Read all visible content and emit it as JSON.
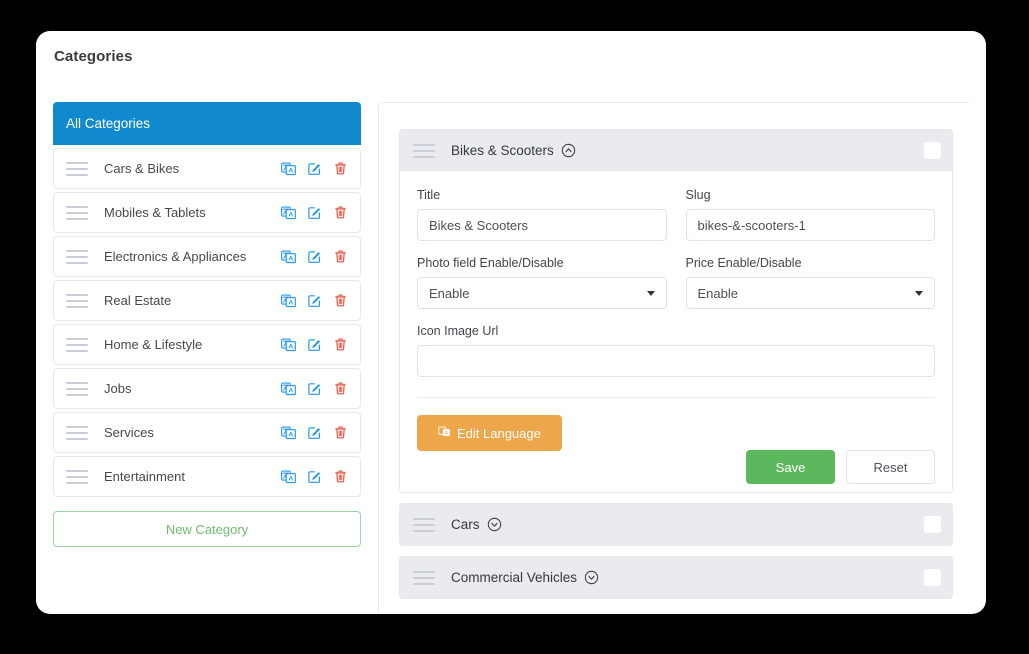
{
  "page": {
    "title": "Categories"
  },
  "sidebar": {
    "header_label": "All Categories",
    "new_category_label": "New Category",
    "row_icons": {
      "drag": "drag-handle-icon",
      "translate": "translate-icon",
      "edit": "edit-pencil-icon",
      "delete": "trash-icon"
    },
    "items": [
      {
        "label": "Cars & Bikes"
      },
      {
        "label": "Mobiles & Tablets"
      },
      {
        "label": "Electronics & Appliances"
      },
      {
        "label": "Real Estate"
      },
      {
        "label": "Home & Lifestyle"
      },
      {
        "label": "Jobs"
      },
      {
        "label": "Services"
      },
      {
        "label": "Entertainment"
      }
    ]
  },
  "main": {
    "panels": [
      {
        "title": "Bikes & Scooters",
        "expanded": true,
        "caret_icon": "chevron-up-circle-icon",
        "checked": false
      },
      {
        "title": "Cars",
        "expanded": false,
        "caret_icon": "chevron-down-circle-icon",
        "checked": false
      },
      {
        "title": "Commercial Vehicles",
        "expanded": false,
        "caret_icon": "chevron-down-circle-icon",
        "checked": false
      }
    ],
    "form": {
      "title_label": "Title",
      "title_value": "Bikes & Scooters",
      "title_placeholder": "Title",
      "slug_label": "Slug",
      "slug_value": "bikes-&-scooters-1",
      "slug_placeholder": "Slug",
      "photo_label": "Photo field Enable/Disable",
      "photo_value": "Enable",
      "price_label": "Price Enable/Disable",
      "price_value": "Enable",
      "icon_url_label": "Icon Image Url",
      "icon_url_value": "",
      "icon_url_placeholder": "",
      "edit_language_label": "Edit Language",
      "save_label": "Save",
      "reset_label": "Reset"
    }
  },
  "colors": {
    "accent_blue": "#1189ce",
    "save_green": "#5cb85c",
    "new_category_green": "#72bb72",
    "edit_language_orange": "#eda74a",
    "delete_red": "#e74c3c",
    "edit_blue": "#2196f3",
    "panel_header_gray": "#e9ebef"
  }
}
